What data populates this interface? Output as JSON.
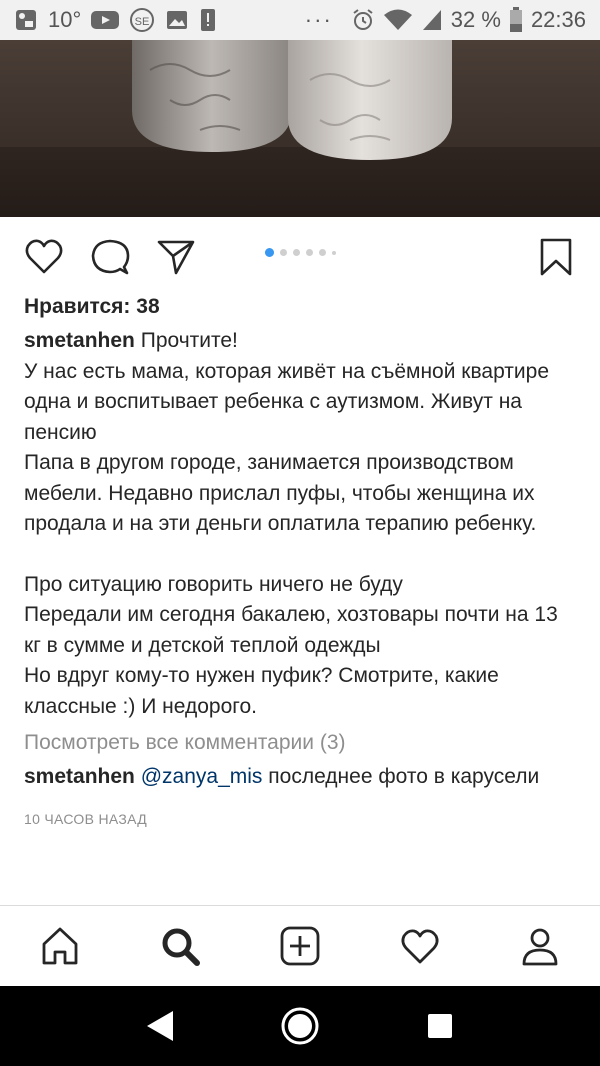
{
  "status_bar": {
    "temperature": "10°",
    "battery": "32 %",
    "time": "22:36",
    "overflow": "···",
    "icons": [
      "photo-app-icon",
      "youtube-icon",
      "se-icon",
      "gallery-icon",
      "alert-icon",
      "alarm-icon",
      "wifi-icon",
      "signal-icon",
      "battery-icon"
    ]
  },
  "post": {
    "photo_icon": "pouf-photo",
    "carousel_count": 6,
    "carousel_active": 0,
    "likes": "Нравится: 38",
    "caption": {
      "username": "smetanhen",
      "first_line": "Прочтите!",
      "para1": "У нас есть мама, которая живёт на съёмной квартире одна и воспитывает ребенка с аутизмом. Живут на пенсию\nПапа в другом городе, занимается производством мебели. Недавно прислал пуфы, чтобы женщина их продала и на эти деньги оплатила терапию ребенку.",
      "para2": "Про ситуацию говорить ничего не буду\nПередали им сегодня бакалею, хозтовары почти на 13 кг в сумме и детской теплой одежды\nНо вдруг кому-то нужен пуфик? Смотрите, какие классные :) И недорого."
    },
    "view_all_comments": "Посмотреть все комментарии (3)",
    "comment": {
      "username": "smetanhen",
      "mention": "@zanya_mis",
      "text": "последнее фото в карусели"
    },
    "timestamp": "10 ЧАСОВ НАЗАД"
  },
  "colors": {
    "accent": "#3897f0",
    "mention": "#003569",
    "muted": "#8e8e8e"
  }
}
